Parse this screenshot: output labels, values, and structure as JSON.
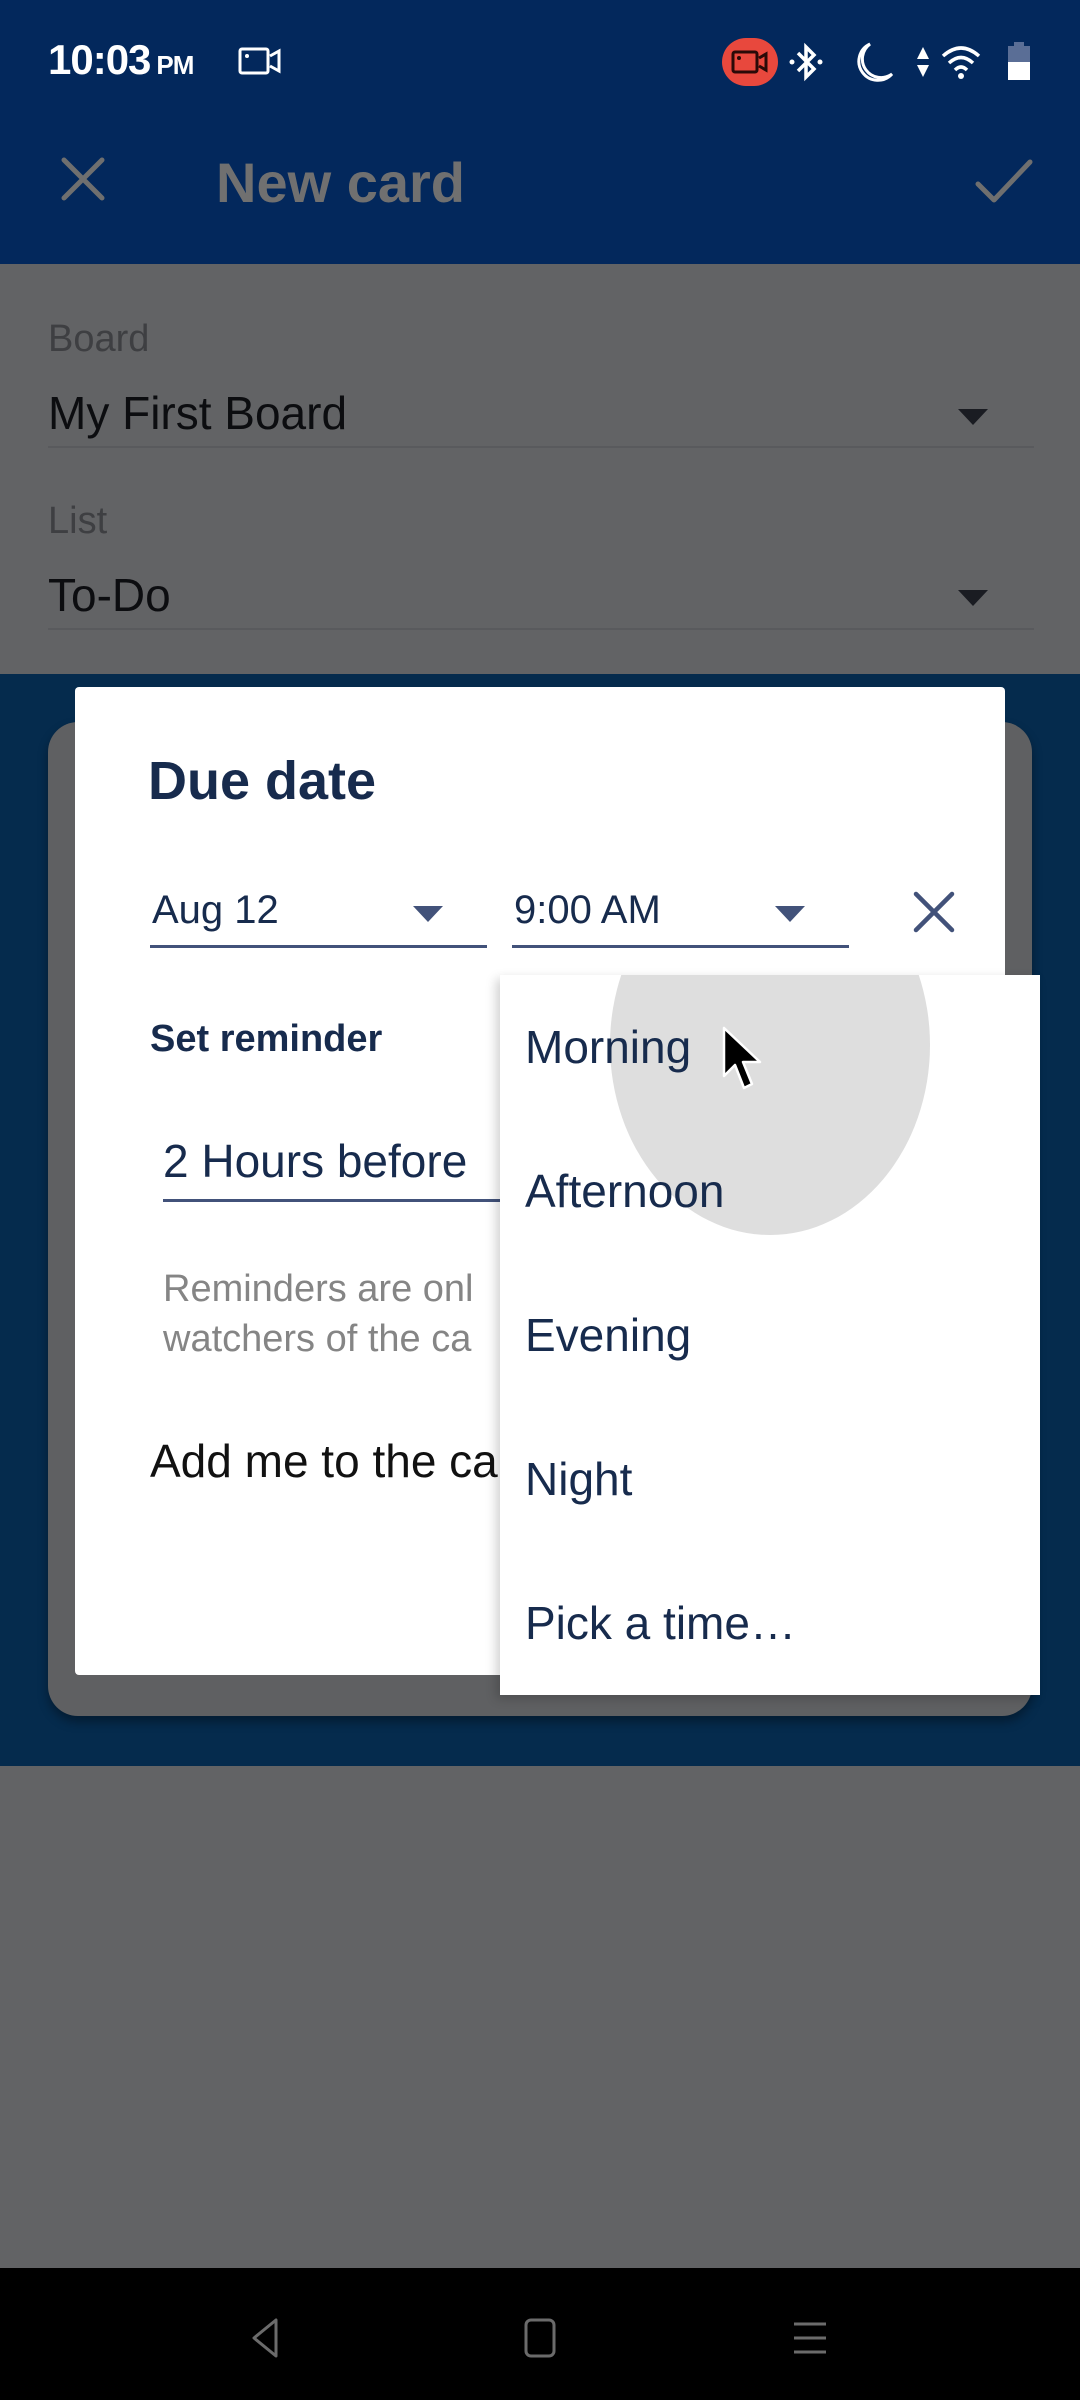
{
  "status_bar": {
    "time": "10:03",
    "ampm": "PM",
    "icons": [
      "screen-record-icon",
      "recording-active-icon",
      "bluetooth-icon",
      "do-not-disturb-icon",
      "data-arrows-icon",
      "wifi-icon",
      "battery-icon"
    ],
    "recording_color": "#e8483d"
  },
  "app_bar": {
    "title": "New card",
    "close_icon": "close-icon",
    "confirm_icon": "check-icon",
    "background": "#03285c"
  },
  "form": {
    "board_label": "Board",
    "board_value": "My First Board",
    "list_label": "List",
    "list_value": "To-Do"
  },
  "dialog": {
    "title": "Due date",
    "date_value": "Aug 12",
    "time_value": "9:00 AM",
    "set_reminder_label": "Set reminder",
    "reminder_value": "2 Hours before",
    "reminder_help": "Reminders are only sent to members and watchers of the card.",
    "reminder_help_line1": "Reminders are onl",
    "reminder_help_line2": "watchers of the ca",
    "watch_label": "Add me to the card"
  },
  "time_menu": {
    "items": [
      {
        "label": "Morning",
        "pressed": true
      },
      {
        "label": "Afternoon"
      },
      {
        "label": "Evening"
      },
      {
        "label": "Night"
      },
      {
        "label": "Pick a time…"
      }
    ]
  },
  "nav_bar": {
    "buttons": [
      "back-icon",
      "home-icon",
      "recents-icon"
    ]
  }
}
